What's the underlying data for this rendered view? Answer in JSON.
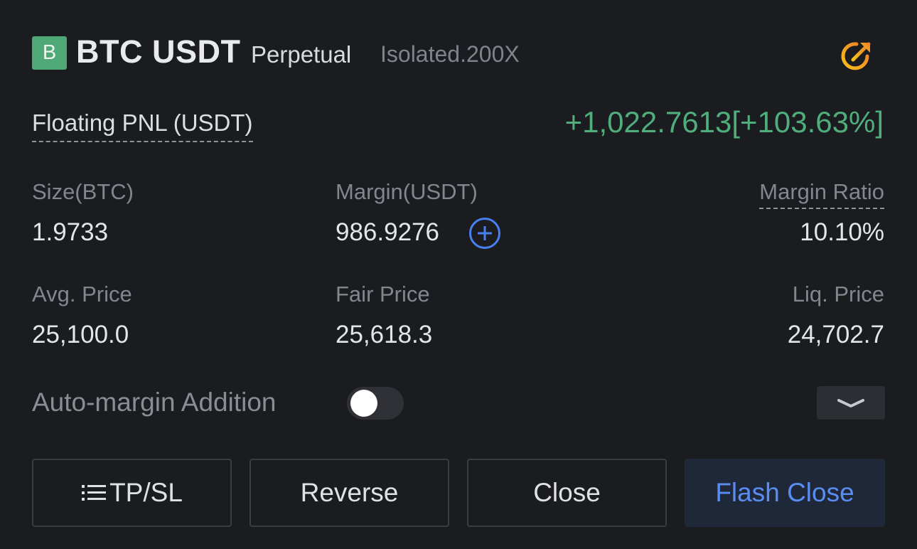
{
  "header": {
    "badge_letter": "B",
    "symbol": "BTC USDT",
    "contract_type": "Perpetual",
    "margin_mode": "Isolated.200X",
    "share_icon": "share-arrow-icon"
  },
  "pnl": {
    "label": "Floating PNL (USDT)",
    "value": "+1,022.7613[+103.63%]"
  },
  "stats": {
    "size_label": "Size(BTC)",
    "size_value": "1.9733",
    "margin_label": "Margin(USDT)",
    "margin_value": "986.9276",
    "margin_ratio_label": "Margin Ratio",
    "margin_ratio_value": "10.10%",
    "avg_price_label": "Avg. Price",
    "avg_price_value": "25,100.0",
    "fair_price_label": "Fair Price",
    "fair_price_value": "25,618.3",
    "liq_price_label": "Liq. Price",
    "liq_price_value": "24,702.7"
  },
  "auto_margin": {
    "label": "Auto-margin Addition",
    "enabled": false
  },
  "buttons": {
    "tpsl": "TP/SL",
    "reverse": "Reverse",
    "close": "Close",
    "flash_close": "Flash Close"
  },
  "colors": {
    "background": "#1b1c20",
    "positive": "#4fae7b",
    "accent_blue": "#4a7ff0",
    "badge": "#4fa977"
  }
}
